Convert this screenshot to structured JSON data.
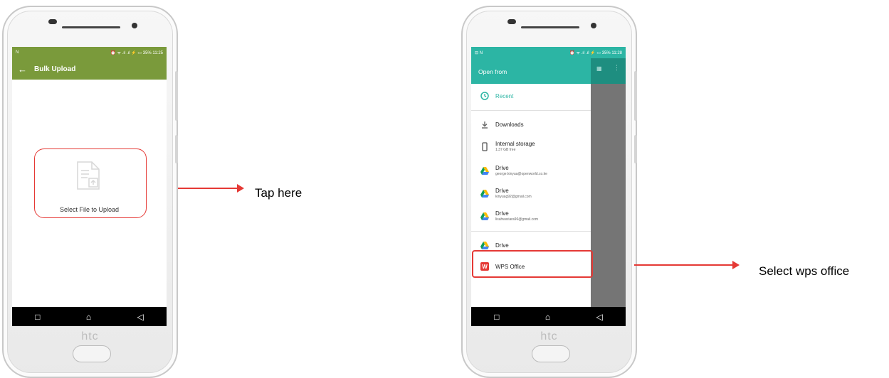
{
  "left_phone": {
    "brand": "htc",
    "status_left": "N",
    "status_right": "⏰ ᯤ .ıl .ıl ⚡ ▭ 35% 11:25",
    "appbar_title": "Bulk Upload",
    "back_icon": "←",
    "select_file_label": "Select File to Upload",
    "nav": [
      "□",
      "⌂",
      "◁"
    ]
  },
  "right_phone": {
    "brand": "htc",
    "status_left": "⊟ N",
    "status_right": "⏰ ᯤ .ıl .ıl ⚡ ▭ 35% 11:28",
    "header_title": "Open from",
    "items": [
      {
        "label": "Recent",
        "sub": ""
      },
      {
        "label": "Downloads",
        "sub": ""
      },
      {
        "label": "Internal storage",
        "sub": "1.37 GB free"
      },
      {
        "label": "Drive",
        "sub": "george.kinyua@openworld.co.ke"
      },
      {
        "label": "Drive",
        "sub": "kinyuag92@gmail.com"
      },
      {
        "label": "Drive",
        "sub": "lisahwariara96@gmail.com"
      },
      {
        "label": "Drive",
        "sub": ""
      },
      {
        "label": "WPS Office",
        "sub": ""
      }
    ],
    "nav": [
      "□",
      "⌂",
      "◁"
    ]
  },
  "annotations": {
    "tap_here": "Tap here",
    "select_wps": "Select wps office"
  },
  "colors": {
    "left_appbar": "#7a9a3b",
    "right_header": "#2cb5a4",
    "highlight_red": "#e53935"
  }
}
